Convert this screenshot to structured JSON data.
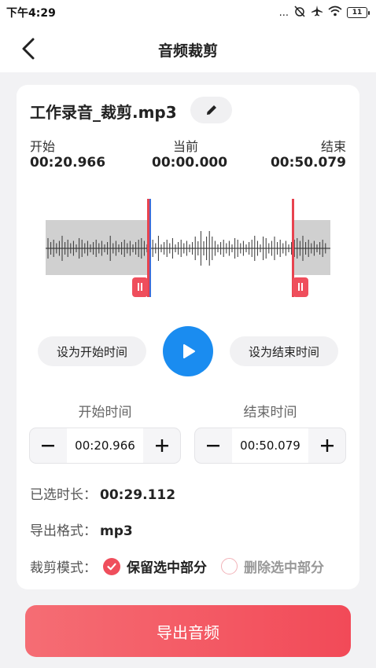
{
  "status_bar": {
    "time": "下午4:29",
    "icons_text": "...",
    "battery": "11"
  },
  "nav": {
    "title": "音频裁剪",
    "back_icon": "chevron-left-icon"
  },
  "file": {
    "name": "工作录音_裁剪.mp3",
    "edit_icon": "pencil-icon"
  },
  "times": {
    "start_label": "开始",
    "start_value": "00:20.966",
    "current_label": "当前",
    "current_value": "00:00.000",
    "end_label": "结束",
    "end_value": "00:50.079"
  },
  "waveform": {
    "start_fraction": 0.36,
    "end_fraction": 0.87
  },
  "actions": {
    "set_start": "设为开始时间",
    "set_end": "设为结束时间",
    "play_icon": "play-icon"
  },
  "start_time": {
    "label": "开始时间",
    "value": "00:20.966"
  },
  "end_time": {
    "label": "结束时间",
    "value": "00:50.079"
  },
  "selected_duration": {
    "label": "已选时长：",
    "value": "00:29.112"
  },
  "export_format": {
    "label": "导出格式：",
    "value": "mp3"
  },
  "crop_mode": {
    "label": "裁剪模式：",
    "options": [
      {
        "label": "保留选中部分",
        "checked": true
      },
      {
        "label": "删除选中部分",
        "checked": false
      }
    ]
  },
  "export_button": "导出音频",
  "colors": {
    "accent_red": "#ef4e5c",
    "play_blue": "#1a8cf0",
    "playhead_blue": "#3d6ed8"
  }
}
